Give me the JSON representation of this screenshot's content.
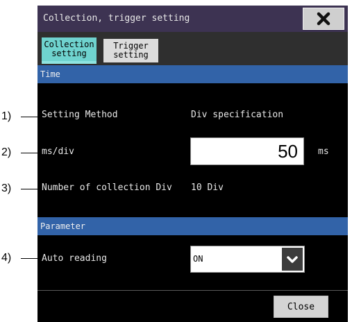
{
  "window": {
    "title": "Collection, trigger setting"
  },
  "tabs": [
    {
      "label": "Collection\nsetting",
      "active": true
    },
    {
      "label": "Trigger\nsetting",
      "active": false
    }
  ],
  "sections": {
    "time": "Time",
    "parameter": "Parameter"
  },
  "fields": {
    "setting_method": {
      "label": "Setting Method",
      "value": "Div specification"
    },
    "ms_div": {
      "label": "ms/div",
      "value": "50",
      "unit": "ms"
    },
    "collection_div": {
      "label": "Number of collection Div",
      "value": "10 Div"
    },
    "auto_reading": {
      "label": "Auto reading",
      "value": "ON"
    }
  },
  "buttons": {
    "close": "Close"
  },
  "callouts": [
    "1)",
    "2)",
    "3)",
    "4)"
  ],
  "colors": {
    "titlebar": "#3d3352",
    "section": "#3263a8",
    "active_tab": "#6fd3cf",
    "background": "#000000"
  }
}
